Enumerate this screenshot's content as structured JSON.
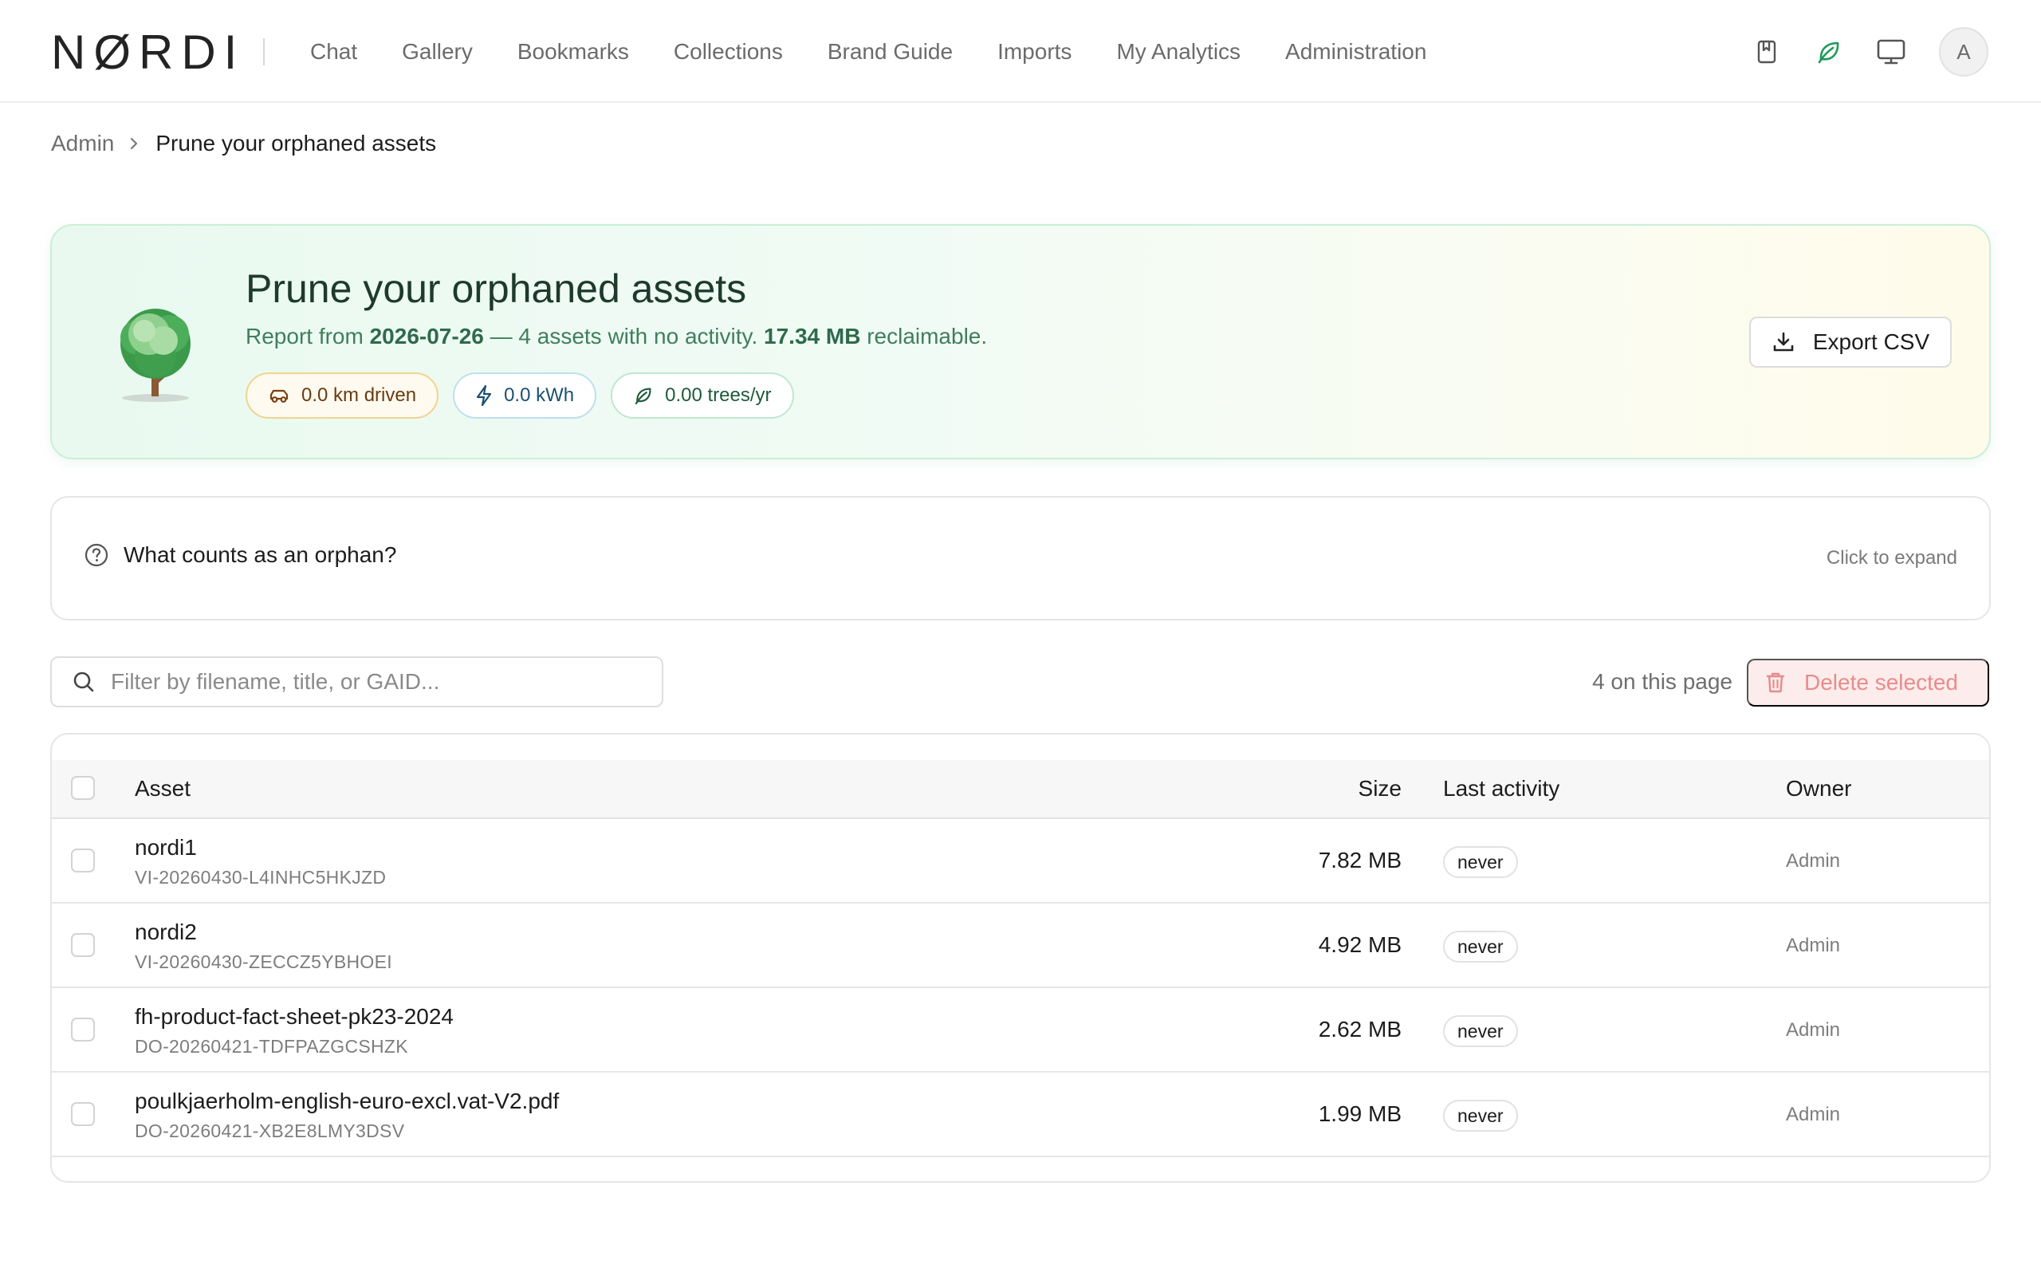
{
  "app": {
    "logo_text": "NØRDI",
    "nav": [
      "Chat",
      "Gallery",
      "Bookmarks",
      "Collections",
      "Brand Guide",
      "Imports",
      "My Analytics",
      "Administration"
    ],
    "avatar_initial": "A",
    "top_icons": [
      "bookmark-icon",
      "leaf-icon",
      "monitor-icon"
    ]
  },
  "breadcrumb": {
    "parent": "Admin",
    "current": "Prune your orphaned assets"
  },
  "hero": {
    "title": "Prune your orphaned assets",
    "sub_prefix": "Report from ",
    "report_date": "2026-07-26",
    "sub_mid": " — 4 assets with no activity. ",
    "reclaimable": "17.34 MB",
    "sub_suffix": " reclaimable.",
    "chips": {
      "km": "0.0 km driven",
      "kwh": "0.0 kWh",
      "trees": "0.00 trees/yr"
    },
    "export_label": "Export CSV"
  },
  "faq": {
    "question": "What counts as an orphan?",
    "hint": "Click to expand"
  },
  "toolbar": {
    "search_placeholder": "Filter by filename, title, or GAID...",
    "count_text": "4 on this page",
    "delete_label": "Delete selected"
  },
  "table": {
    "headers": {
      "asset": "Asset",
      "size": "Size",
      "last_activity": "Last activity",
      "owner": "Owner"
    },
    "rows": [
      {
        "name": "nordi1",
        "id": "VI-20260430-L4INHC5HKJZD",
        "size": "7.82 MB",
        "last_activity": "never",
        "owner": "Admin"
      },
      {
        "name": "nordi2",
        "id": "VI-20260430-ZECCZ5YBHOEI",
        "size": "4.92 MB",
        "last_activity": "never",
        "owner": "Admin"
      },
      {
        "name": "fh-product-fact-sheet-pk23-2024",
        "id": "DO-20260421-TDFPAZGCSHZK",
        "size": "2.62 MB",
        "last_activity": "never",
        "owner": "Admin"
      },
      {
        "name": "poulkjaerholm-english-euro-excl.vat-V2.pdf",
        "id": "DO-20260421-XB2E8LMY3DSV",
        "size": "1.99 MB",
        "last_activity": "never",
        "owner": "Admin"
      }
    ]
  },
  "colors": {
    "accent_green": "#2f6a4b",
    "delete_red": "#e98b8b",
    "leaf_icon": "#1f9a5a"
  }
}
